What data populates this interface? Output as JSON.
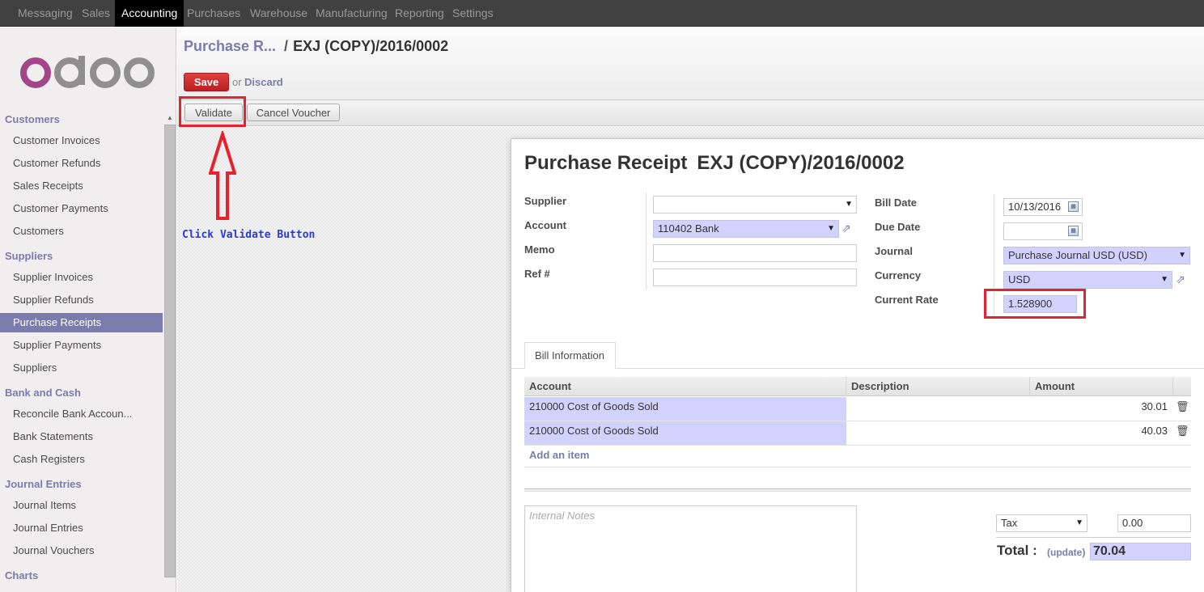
{
  "topnav": {
    "items": [
      "Messaging",
      "Sales",
      "Accounting",
      "Purchases",
      "Warehouse",
      "Manufacturing",
      "Reporting",
      "Settings"
    ],
    "active": "Accounting"
  },
  "logo_text": "odoo",
  "sidebar": {
    "sections": [
      {
        "title": "Customers",
        "items": [
          "Customer Invoices",
          "Customer Refunds",
          "Sales Receipts",
          "Customer Payments",
          "Customers"
        ]
      },
      {
        "title": "Suppliers",
        "items": [
          "Supplier Invoices",
          "Supplier Refunds",
          "Purchase Receipts",
          "Supplier Payments",
          "Suppliers"
        ]
      },
      {
        "title": "Bank and Cash",
        "items": [
          "Reconcile Bank Accoun...",
          "Bank Statements",
          "Cash Registers"
        ]
      },
      {
        "title": "Journal Entries",
        "items": [
          "Journal Items",
          "Journal Entries",
          "Journal Vouchers"
        ]
      },
      {
        "title": "Charts",
        "items": []
      }
    ],
    "active_item": "Purchase Receipts"
  },
  "breadcrumb": {
    "parent": "Purchase R...",
    "separator": "/",
    "current": "EXJ (COPY)/2016/0002"
  },
  "header": {
    "save_label": "Save",
    "or_text": "or",
    "discard_label": "Discard"
  },
  "toolbar": {
    "validate_label": "Validate",
    "cancel_voucher_label": "Cancel Voucher"
  },
  "annotation": {
    "text": "Click Validate Button"
  },
  "form": {
    "title": "Purchase Receipt",
    "reference": "EXJ (COPY)/2016/0002",
    "left_labels": {
      "supplier": "Supplier",
      "account": "Account",
      "memo": "Memo",
      "ref": "Ref #"
    },
    "supplier": "",
    "account": "110402 Bank",
    "memo": "",
    "ref": "",
    "right_labels": {
      "bill_date": "Bill Date",
      "due_date": "Due Date",
      "journal": "Journal",
      "currency": "Currency",
      "current_rate": "Current Rate"
    },
    "bill_date": "10/13/2016",
    "due_date": "",
    "journal": "Purchase Journal USD (USD)",
    "currency": "USD",
    "current_rate": "1.528900"
  },
  "tab": {
    "label": "Bill Information"
  },
  "lines": {
    "headers": {
      "account": "Account",
      "description": "Description",
      "amount": "Amount"
    },
    "rows": [
      {
        "account": "210000 Cost of Goods Sold",
        "description": "",
        "amount": "30.01"
      },
      {
        "account": "210000 Cost of Goods Sold",
        "description": "",
        "amount": "40.03"
      }
    ],
    "add_item_label": "Add an item"
  },
  "footer": {
    "notes_placeholder": "Internal Notes",
    "tax_label": "Tax",
    "tax_value": "0.00",
    "total_label": "Total :",
    "update_label": "(update)",
    "total_value": "70.04"
  },
  "colors": {
    "accent": "#7c7bad",
    "required_field": "#d2d2ff",
    "save_button": "#d03232",
    "highlight_box": "#e3232d",
    "annotation_text": "#2b3bd1"
  }
}
